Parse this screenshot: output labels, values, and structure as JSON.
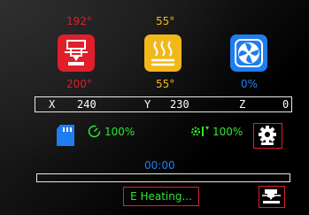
{
  "extruder": {
    "current": "192°",
    "target": "200°"
  },
  "bed": {
    "current": "55°",
    "target": "55°"
  },
  "fan": {
    "speed": "0%"
  },
  "coords": {
    "x_label": "X",
    "x_value": "240",
    "y_label": "Y",
    "y_value": "230",
    "z_label": "Z",
    "z_value": "0"
  },
  "print_speed": "100%",
  "flow_rate": "100%",
  "elapsed_time": "00:00",
  "progress": 0,
  "status_text": "E Heating...",
  "colors": {
    "red": "#e01f2b",
    "yellow": "#f2b81b",
    "blue": "#1f7df0",
    "green": "#2ee62e"
  },
  "icons": [
    "extruder-icon",
    "heated-bed-icon",
    "fan-icon",
    "sd-card-icon",
    "speed-gauge-icon",
    "flow-rate-icon",
    "settings-gear-icon",
    "printer-menu-icon"
  ]
}
